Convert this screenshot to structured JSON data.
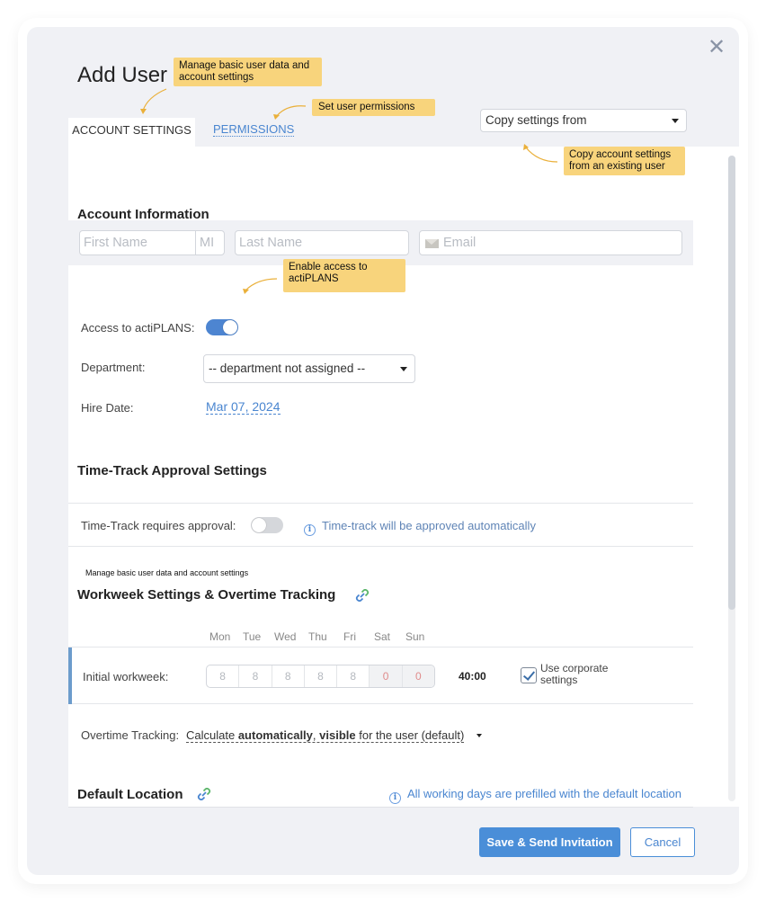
{
  "dialog": {
    "title": "Add User",
    "close_icon": "close-icon",
    "tabs": [
      {
        "label": "ACCOUNT SETTINGS",
        "active": true
      },
      {
        "label": "PERMISSIONS",
        "active": false
      }
    ],
    "copy_settings": {
      "value": "Copy settings from"
    }
  },
  "account_info": {
    "title": "Account Information",
    "first_name_placeholder": "First Name",
    "mi_placeholder": "MI",
    "last_name_placeholder": "Last Name",
    "email_placeholder": "Email",
    "access_label": "Access to actiPLANS:",
    "access_enabled": true,
    "department_label": "Department:",
    "department_value": "-- department not assigned --",
    "hire_date_label": "Hire Date:",
    "hire_date_value": "Mar 07, 2024"
  },
  "approval": {
    "title": "Time-Track Approval Settings",
    "requires_label": "Time-Track requires approval:",
    "requires_enabled": false,
    "info": "Time-track will be approved automatically"
  },
  "workweek": {
    "note": "Manage basic user data and account settings",
    "title": "Workweek Settings & Overtime Tracking",
    "days": [
      "Mon",
      "Tue",
      "Wed",
      "Thu",
      "Fri",
      "Sat",
      "Sun"
    ],
    "hours": [
      "8",
      "8",
      "8",
      "8",
      "8",
      "0",
      "0"
    ],
    "row_label": "Initial workweek:",
    "total": "40:00",
    "corporate_label": "Use corporate settings",
    "corporate_checked": true,
    "overtime_label": "Overtime Tracking:",
    "overtime_parts": [
      "Calculate ",
      "automatically",
      ", ",
      "visible",
      " for the user (default)"
    ]
  },
  "location": {
    "title": "Default Location",
    "info": "All working days are prefilled with the default location"
  },
  "footer": {
    "save_label": "Save & Send Invitation",
    "cancel_label": "Cancel"
  },
  "callouts": {
    "account": "Manage basic user data and account settings",
    "permissions": "Set user permissions",
    "copy": "Copy account settings from an existing user",
    "access": "Enable access to actiPLANS"
  },
  "colors": {
    "accent": "#4a8ed8",
    "callout": "#f8d47c",
    "weekend_hours": "#e08c8c"
  }
}
